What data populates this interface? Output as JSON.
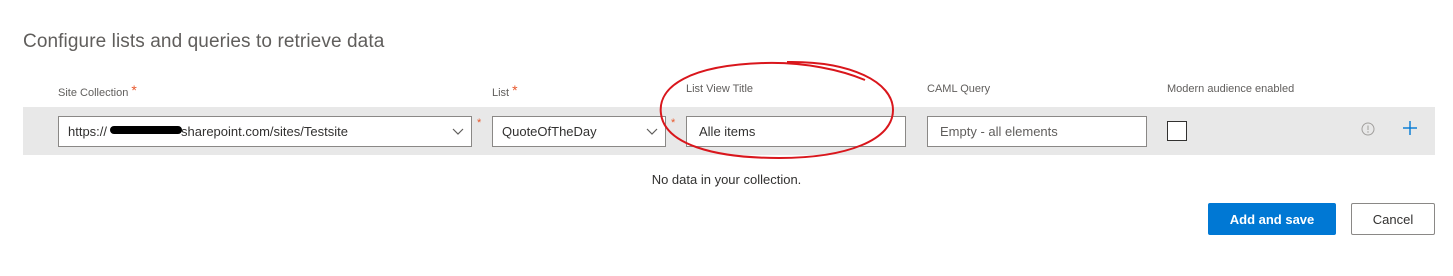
{
  "page": {
    "title": "Configure lists and queries to retrieve data"
  },
  "columns": {
    "site_collection": {
      "label": "Site Collection",
      "required_mark": "*"
    },
    "list": {
      "label": "List",
      "required_mark": "*"
    },
    "list_view_title": {
      "label": "List View Title"
    },
    "caml_query": {
      "label": "CAML Query"
    },
    "modern_audience": {
      "label": "Modern audience enabled"
    }
  },
  "row": {
    "site_collection_value_start": "https://",
    "site_collection_value_end": "sharepoint.com/sites/Testsite",
    "site_collection_required": "*",
    "list_value": "QuoteOfTheDay",
    "list_required": "*",
    "list_view_title_value": "Alle items",
    "caml_query_placeholder": "Empty - all elements",
    "modern_audience_checked": false
  },
  "icons": {
    "dropdown": "chevron-down-icon",
    "info": "info-icon",
    "add": "plus-icon"
  },
  "empty_message": "No data in your collection.",
  "buttons": {
    "add_and_save": "Add and save",
    "cancel": "Cancel"
  },
  "colors": {
    "accent": "#0078d4",
    "required": "#e8582c",
    "row_band": "#e8e8e8",
    "annotation": "#d9161c"
  }
}
